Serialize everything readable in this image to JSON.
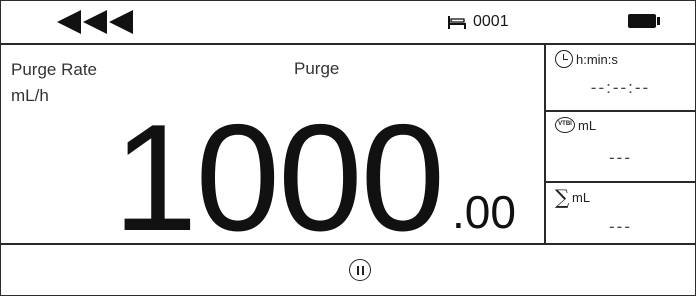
{
  "status_bar": {
    "bed_number": "0001",
    "icons": {
      "back": "triple-left-arrow-icon",
      "bed": "bed-icon",
      "battery": "battery-full-icon"
    }
  },
  "main": {
    "rate_label": "Purge Rate",
    "unit": "mL/h",
    "mode": "Purge",
    "value_integer": "1000",
    "value_decimal": ".00"
  },
  "side_panels": [
    {
      "icon": "clock-icon",
      "unit": "h:min:s",
      "value": "--:--:--"
    },
    {
      "icon": "vtbi-icon",
      "icon_text": "VTBI",
      "unit": "mL",
      "value": "---"
    },
    {
      "icon": "sigma-icon",
      "icon_text": "∑",
      "unit": "mL",
      "value": "---"
    }
  ],
  "bottom_bar": {
    "pause_icon": "pause-icon"
  },
  "colors": {
    "background": "#ffffff",
    "foreground": "#111111",
    "border": "#2a2a2a"
  }
}
